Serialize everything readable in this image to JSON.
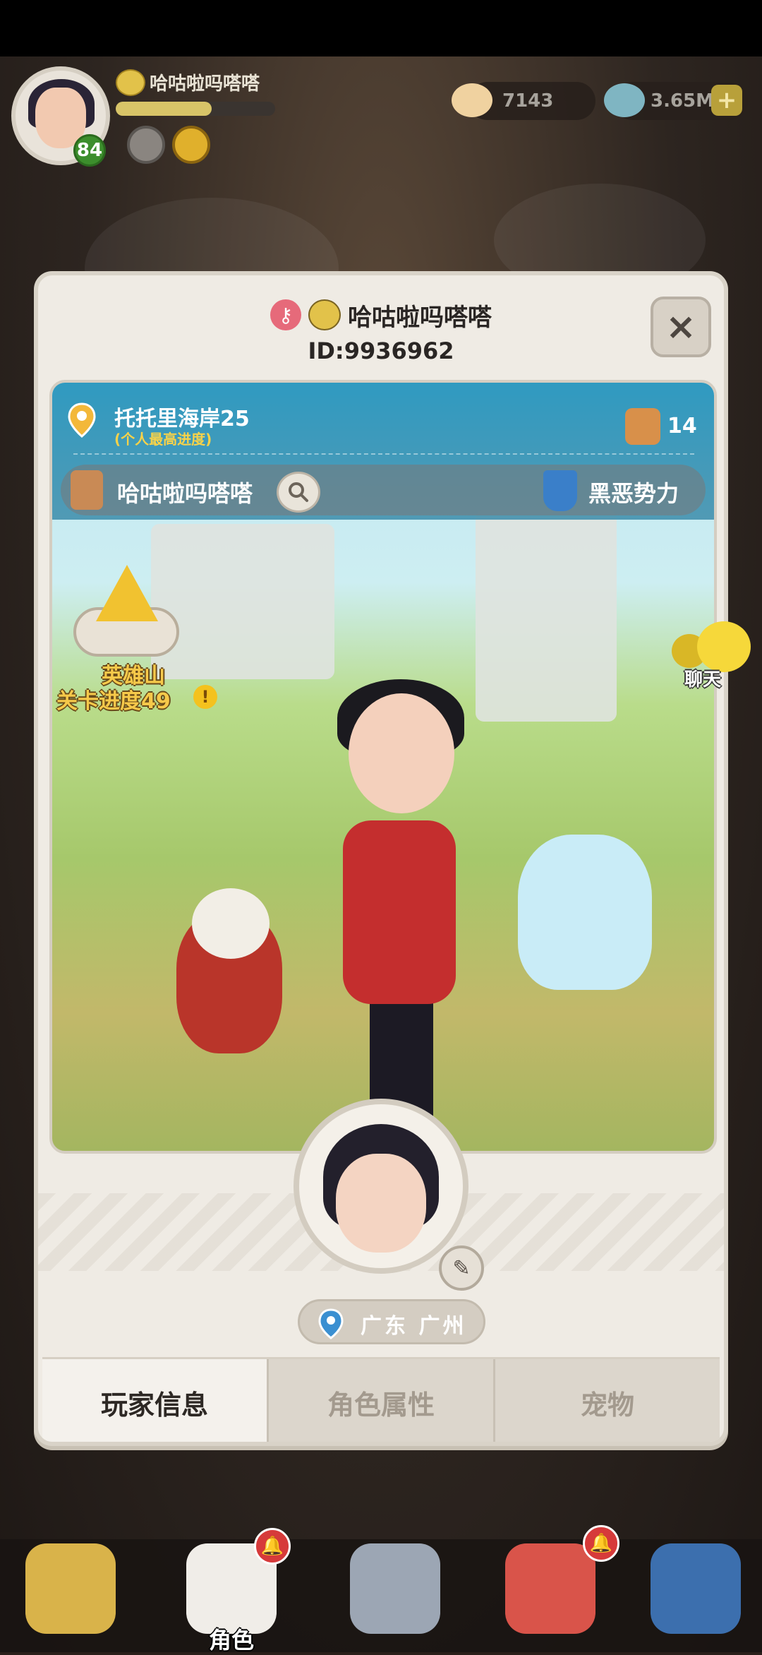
{
  "hud": {
    "player_name": "哈咕啦吗嗒嗒",
    "level": "84",
    "xp_fraction": 0.6,
    "currency_1": {
      "icon": "shell-coin-icon",
      "value": "7143"
    },
    "currency_2": {
      "icon": "gem-stone-icon",
      "value": "3.65M"
    },
    "plus_label": "+"
  },
  "profile": {
    "title_name": "哈咕啦吗嗒嗒",
    "player_id": "ID:9936962",
    "close_label": "×",
    "location": "托托里海岸25",
    "location_sub": "(个人最高进度)",
    "friend_count": "14",
    "guild_name": "哈咕啦吗嗒嗒",
    "faction_name": "黑恶势力",
    "mountain_label": "英雄山",
    "stage_progress": "关卡进度49",
    "info_label": "!",
    "chat_label": "聊天",
    "region": "广东 广州"
  },
  "tabs": [
    {
      "label": "玩家信息",
      "active": true
    },
    {
      "label": "角色属性",
      "active": false
    },
    {
      "label": "宠物",
      "active": false
    }
  ],
  "bottom_nav": {
    "character_label": "角色"
  },
  "colors": {
    "accent_blue": "#2896be",
    "gold_text": "#f6c94a",
    "panel_bg": "#efebe4",
    "level_green": "#3c8e2c"
  }
}
